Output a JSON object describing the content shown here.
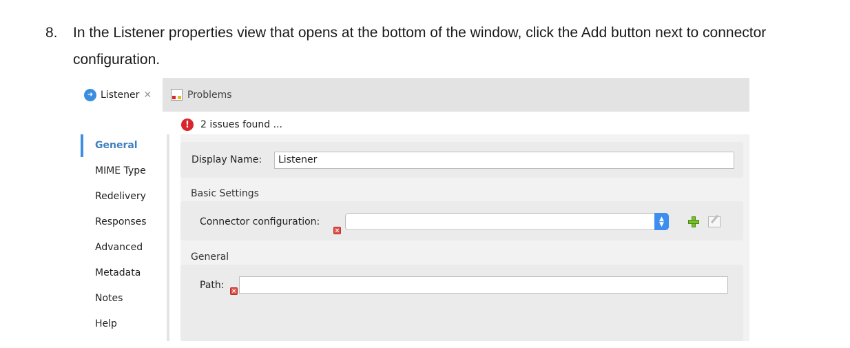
{
  "instruction": {
    "number": "8.",
    "text": "In the Listener properties view that opens at the bottom of the window, click the Add button next to connector configuration."
  },
  "tabs": [
    {
      "label": "Listener",
      "icon": "listener-icon",
      "active": true,
      "close": "✕"
    },
    {
      "label": "Problems",
      "icon": "problems-icon",
      "active": false
    }
  ],
  "issues": {
    "icon": "error-icon",
    "mark": "!",
    "text": "2 issues found ..."
  },
  "nav": {
    "items": [
      "General",
      "MIME Type",
      "Redelivery",
      "Responses",
      "Advanced",
      "Metadata",
      "Notes",
      "Help"
    ],
    "active": "General"
  },
  "general": {
    "display_name_label": "Display Name:",
    "display_name_value": "Listener"
  },
  "basic_settings": {
    "title": "Basic Settings",
    "connector_label": "Connector configuration:",
    "connector_value": "",
    "add_icon": "add-plus-icon",
    "edit_icon": "edit-icon"
  },
  "general_section": {
    "title": "General",
    "path_label": "Path:",
    "path_value": ""
  },
  "colors": {
    "accent": "#3e8ef0",
    "error": "#d9262c",
    "active_nav": "#3d7fc0",
    "add": "#7bbf2c"
  }
}
